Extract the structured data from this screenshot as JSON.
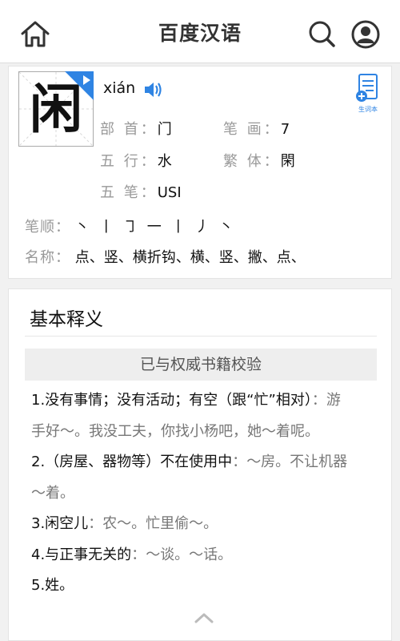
{
  "header": {
    "title": "百度汉语"
  },
  "character": {
    "glyph": "闲",
    "pinyin": "xián",
    "add_label": "生词本",
    "radical_label": "部 首：",
    "radical": "门",
    "strokes_label": "笔 画：",
    "strokes": "7",
    "wuxing_label": "五 行：",
    "wuxing": "水",
    "traditional_label": "繁 体：",
    "traditional": "閑",
    "wubi_label": "五 笔：",
    "wubi": "USI",
    "order_label": "笔顺：",
    "order": [
      "丶",
      "丨",
      "㇆",
      "一",
      "丨",
      "丿",
      "丶"
    ],
    "names_label": "名称：",
    "names": "点、竖、横折钩、横、竖、撇、点、"
  },
  "basic": {
    "title": "基本释义",
    "verified": "已与权威书籍校验",
    "d1_text": "1.没有事情；没有活动；有空（跟“忙”相对）",
    "d1_sep": "：",
    "d1_ex_a": "游",
    "d1_ex_b": "手好～。我没工夫，你找小杨吧，她～着呢。",
    "d2_text": "2.（房屋、器物等）不在使用中",
    "d2_sep": "：",
    "d2_ex_a": "～房。不让机器",
    "d2_ex_b": "～着。",
    "d3_text": "3.闲空儿",
    "d3_sep": "：",
    "d3_ex": "农～。忙里偷～。",
    "d4_text": "4.与正事无关的",
    "d4_sep": "：",
    "d4_ex": "～谈。～话。",
    "d5_text": "5.姓。"
  },
  "colors": {
    "accent": "#2f84e3",
    "muted": "#999999"
  },
  "icons": [
    "home-icon",
    "search-icon",
    "user-icon",
    "sound-icon",
    "add-word-icon",
    "chevron-up-icon"
  ]
}
